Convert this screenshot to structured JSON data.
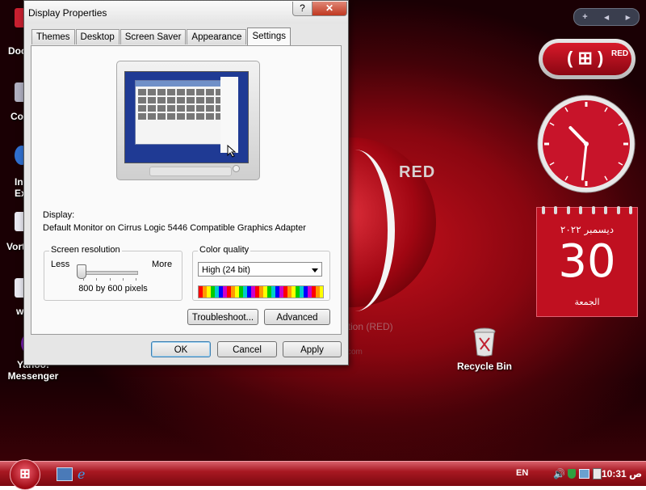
{
  "colors": {
    "accent": "#c01020",
    "dialog_bg": "#e6e6e6",
    "panel_bg": "#fafafa",
    "close": "#c03820"
  },
  "dialog": {
    "title": "Display Properties",
    "help_glyph": "?",
    "close_glyph": "✕",
    "tabs": [
      {
        "label": "Themes"
      },
      {
        "label": "Desktop"
      },
      {
        "label": "Screen Saver"
      },
      {
        "label": "Appearance"
      },
      {
        "label": "Settings",
        "active": true
      }
    ],
    "display_label": "Display:",
    "display_value": "Default Monitor on Cirrus Logic 5446 Compatible Graphics Adapter",
    "resolution": {
      "label": "Screen resolution",
      "less": "Less",
      "more": "More",
      "value_text": "800 by 600 pixels",
      "slider_level": 0.0
    },
    "color_quality": {
      "label": "Color quality",
      "selected": "High (24 bit)"
    },
    "buttons": {
      "troubleshoot": "Troubleshoot...",
      "advanced": "Advanced",
      "ok": "OK",
      "cancel": "Cancel",
      "apply": "Apply"
    }
  },
  "desktop": {
    "bg_text_red": "RED",
    "bg_text_edition": "ration (RED)",
    "bg_text_url": "com",
    "edge_labels": [
      "Doc",
      "Co",
      "In",
      "Ex",
      "Vort",
      "w"
    ],
    "icons": {
      "yahoo_line1": "Yahoo!",
      "yahoo_line2": "Messenger",
      "recycle": "Recycle Bin"
    }
  },
  "gadgets": {
    "sidebar_add": "+",
    "sidebar_prev": "◀",
    "sidebar_next": "▶",
    "brand_logo": "( ⊞ )",
    "brand_text": "RED",
    "clock": {
      "hour": 10,
      "minute": 31
    },
    "calendar": {
      "month_year": "ديسمبر ٢٠٢٢",
      "day": "30",
      "weekday": "الجمعة"
    }
  },
  "taskbar": {
    "start_glyph": "⊞",
    "language": "EN",
    "time": "10:31",
    "ampm": "ص"
  }
}
